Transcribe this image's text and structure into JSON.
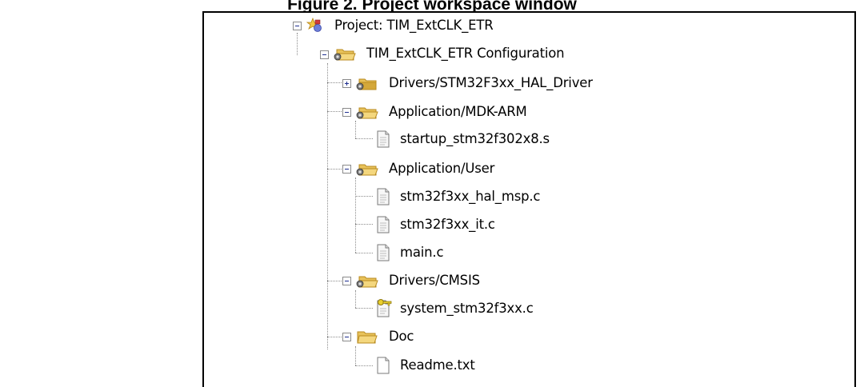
{
  "caption": "Figure 2. Project workspace window",
  "tree": {
    "project": {
      "label": "Project: TIM_ExtCLK_ETR",
      "icon": "project-icon",
      "expanded": true
    },
    "configuration": {
      "label": "TIM_ExtCLK_ETR Configuration",
      "icon": "folder-open-icon",
      "expanded": true
    },
    "groups": [
      {
        "label": "Drivers/STM32F3xx_HAL_Driver",
        "icon": "folder-closed-icon",
        "expanded": false,
        "files": []
      },
      {
        "label": "Application/MDK-ARM",
        "icon": "folder-open-icon",
        "expanded": true,
        "files": [
          {
            "label": "startup_stm32f302x8.s",
            "icon": "file-icon"
          }
        ]
      },
      {
        "label": "Application/User",
        "icon": "folder-open-icon",
        "expanded": true,
        "files": [
          {
            "label": "stm32f3xx_hal_msp.c",
            "icon": "file-icon"
          },
          {
            "label": "stm32f3xx_it.c",
            "icon": "file-icon"
          },
          {
            "label": "main.c",
            "icon": "file-icon"
          }
        ]
      },
      {
        "label": "Drivers/CMSIS",
        "icon": "folder-open-icon",
        "expanded": true,
        "files": [
          {
            "label": "system_stm32f3xx.c",
            "icon": "file-key-icon"
          }
        ]
      },
      {
        "label": "Doc",
        "icon": "folder-open-plain-icon",
        "expanded": true,
        "files": [
          {
            "label": "Readme.txt",
            "icon": "file-icon"
          }
        ]
      }
    ]
  },
  "colors": {
    "folder": "#e8c25a",
    "folder_dark": "#b88a1e",
    "border": "#000000",
    "connector": "#8c8c8c"
  }
}
